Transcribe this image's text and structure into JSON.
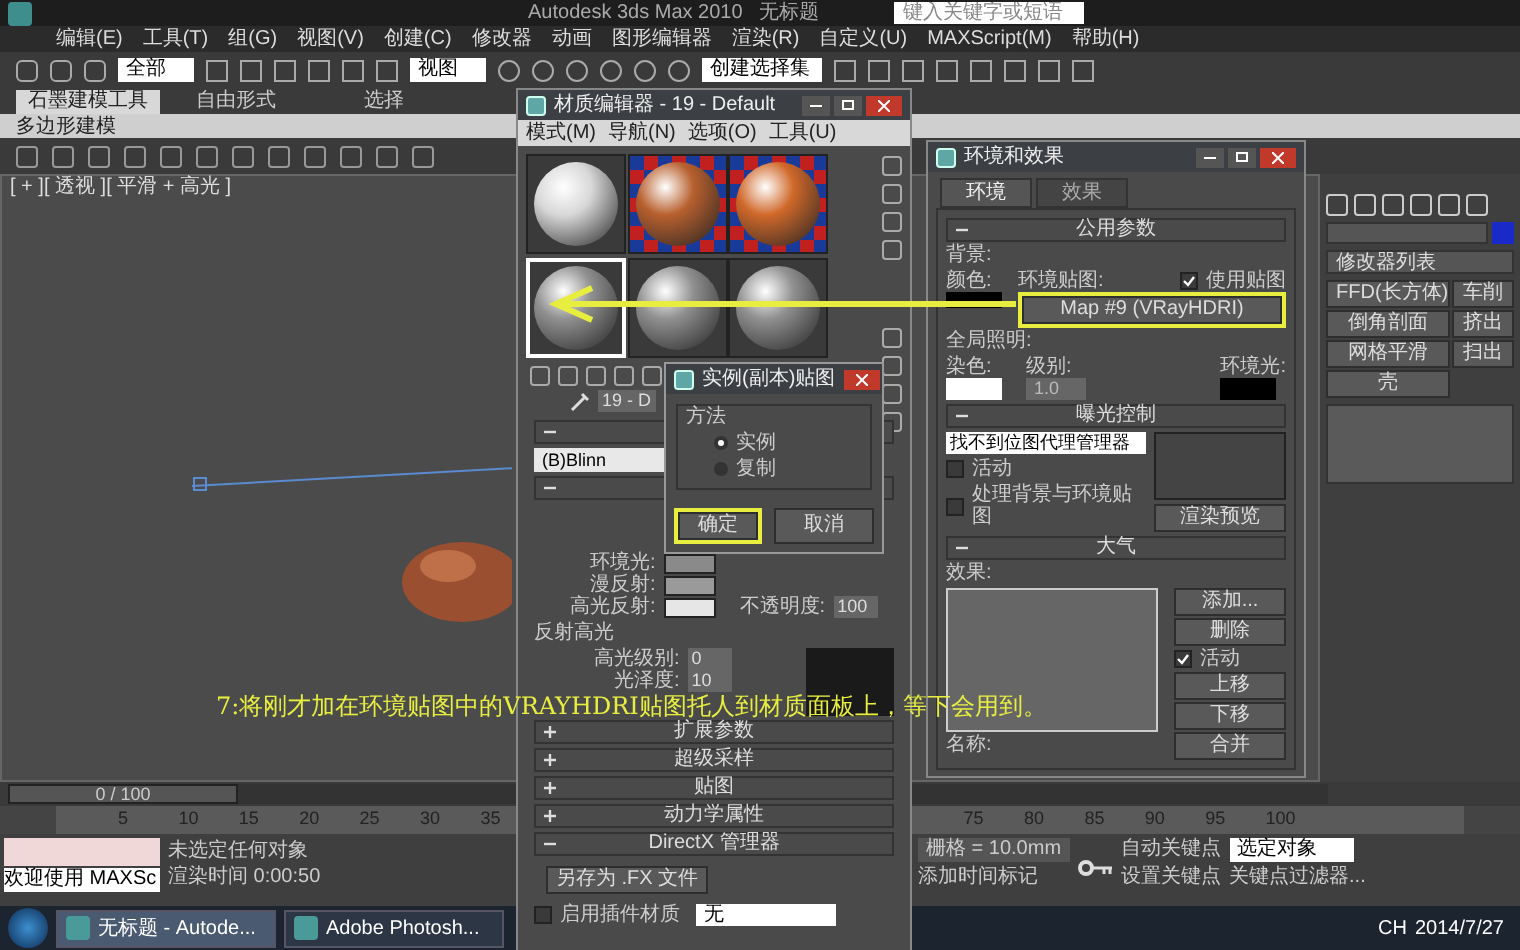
{
  "app_title": "Autodesk 3ds Max 2010",
  "file_title": "无标题",
  "search": {
    "placeholder": "键入关键字或短语"
  },
  "menu": [
    "编辑(E)",
    "工具(T)",
    "组(G)",
    "视图(V)",
    "创建(C)",
    "修改器",
    "动画",
    "图形编辑器",
    "渲染(R)",
    "自定义(U)",
    "MAXScript(M)",
    "帮助(H)"
  ],
  "toolbar": {
    "selection_filter": "全部",
    "coord_system": "视图",
    "selection_set": "创建选择集"
  },
  "ribbon": {
    "tabs": [
      {
        "label": "石墨建模工具",
        "selected": true
      },
      {
        "label": "自由形式",
        "selected": false
      },
      {
        "label": "选择",
        "selected": false
      }
    ],
    "panel": "多边形建模"
  },
  "viewport": {
    "label": "[ + ][ 透视 ][ 平滑 + 高光 ]"
  },
  "caption": "7:将刚才加在环境贴图中的VRAYHDRI贴图托人到材质面板上，等下会用到。",
  "material_editor": {
    "title": "材质编辑器 - 19 - Default",
    "menu": [
      "模式(M)",
      "导航(N)",
      "选项(O)",
      "工具(U)"
    ],
    "slots": [
      {
        "kind": "plain",
        "color": "#d8d8d8",
        "selected": false
      },
      {
        "kind": "checker",
        "color": "#b8602e",
        "selected": false
      },
      {
        "kind": "checker",
        "color": "#d0682a",
        "selected": false
      },
      {
        "kind": "plain",
        "color": "#909090",
        "selected": true
      },
      {
        "kind": "plain",
        "color": "#909090",
        "selected": false
      },
      {
        "kind": "plain",
        "color": "#909090",
        "selected": false
      }
    ],
    "name_field": "19 - D",
    "shader": "(B)Blinn",
    "colors": [
      {
        "label": "环境光:",
        "color": "#8a8a8a"
      },
      {
        "label": "漫反射:",
        "color": "#9a9a9a"
      },
      {
        "label": "高光反射:",
        "color": "#e6e6e6"
      }
    ],
    "opacity": {
      "label": "不透明度:",
      "value": "100"
    },
    "specular": {
      "title": "反射高光",
      "level_label": "高光级别:",
      "level_value": "0",
      "gloss_label": "光泽度:",
      "gloss_value": "10"
    },
    "rollouts": [
      {
        "title": "扩展参数",
        "expanded": false
      },
      {
        "title": "超级采样",
        "expanded": false
      },
      {
        "title": "贴图",
        "expanded": false
      },
      {
        "title": "动力学属性",
        "expanded": false
      },
      {
        "title": "DirectX 管理器",
        "expanded": true
      }
    ],
    "save_fx": "另存为 .FX 文件",
    "plugin": {
      "label": "启用插件材质",
      "checked": false,
      "value": "无"
    }
  },
  "instance_dialog": {
    "title": "实例(副本)贴图",
    "group": "方法",
    "options": [
      {
        "label": "实例",
        "selected": true
      },
      {
        "label": "复制",
        "selected": false
      }
    ],
    "ok": "确定",
    "cancel": "取消"
  },
  "environment": {
    "title": "环境和效果",
    "tabs": [
      {
        "label": "环境",
        "selected": true
      },
      {
        "label": "效果",
        "selected": false
      }
    ],
    "common": {
      "title": "公用参数",
      "background": "背景:",
      "color_label": "颜色:",
      "env_map_label": "环境贴图:",
      "use_map": {
        "label": "使用贴图",
        "checked": true
      },
      "map_button": "Map #9 (VRayHDRI)",
      "gi": "全局照明:",
      "tint_label": "染色:",
      "level_label": "级别:",
      "level_value": "1.0",
      "ambient_label": "环境光:"
    },
    "exposure": {
      "title": "曝光控制",
      "dropdown": "找不到位图代理管理器",
      "active": {
        "label": "活动",
        "checked": false
      },
      "process_bg": {
        "label": "处理背景与环境贴图",
        "checked": false
      },
      "preview": "渲染预览"
    },
    "atmosphere": {
      "title": "大气",
      "effects_label": "效果:",
      "add": "添加...",
      "delete": "删除",
      "active": {
        "label": "活动",
        "checked": true
      },
      "up": "上移",
      "down": "下移",
      "merge": "合并",
      "name_label": "名称:"
    }
  },
  "command_panel": {
    "modifier_list": "修改器列表",
    "buttons": [
      "FFD(长方体)",
      "车削",
      "倒角剖面",
      "挤出",
      "网格平滑",
      "扫出",
      "壳"
    ]
  },
  "timeline": {
    "position": "0 / 100",
    "level": 0,
    "ticks": [
      "5",
      "10",
      "15",
      "20",
      "25",
      "30",
      "35",
      "75",
      "80",
      "85",
      "90",
      "95",
      "100"
    ]
  },
  "status": {
    "welcome": "欢迎使用 MAXSc",
    "selection": "未选定任何对象",
    "render_time": "渲染时间 0:00:50",
    "grid": "栅格 = 10.0mm",
    "add_tag": "添加时间标记",
    "auto_key": "自动关键点",
    "set_key": "设置关键点",
    "key_mode": "选定对象",
    "key_filters": "关键点过滤器..."
  },
  "taskbar": {
    "items": [
      {
        "label": "无标题 - Autode...",
        "active": true
      },
      {
        "label": "Adobe Photosh...",
        "active": false
      }
    ],
    "lang": "CH",
    "date": "2014/7/27"
  }
}
